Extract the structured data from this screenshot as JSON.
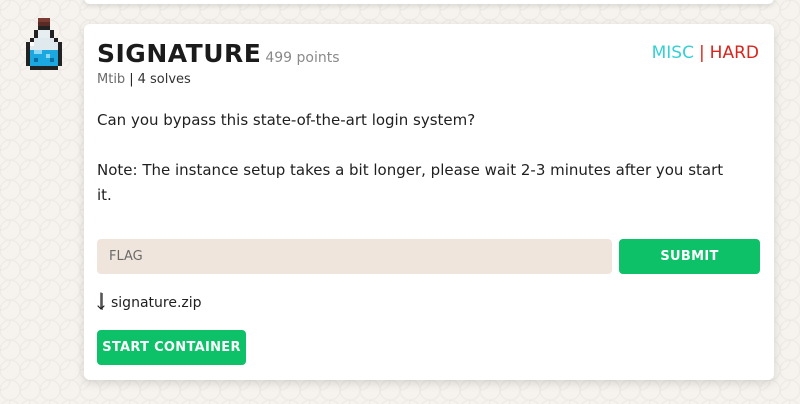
{
  "challenge": {
    "name": "SIGNATURE",
    "points": "499 points",
    "author": "Mtib",
    "separator": "|",
    "solves": "4 solves",
    "category": "MISC",
    "difficulty": "HARD",
    "description": [
      "Can you bypass this state-of-the-art login system?",
      "Note: The instance setup takes a bit longer, please wait 2-3 minutes after you start it."
    ]
  },
  "flag_form": {
    "placeholder": "FLAG",
    "value": "",
    "submit_label": "SUBMIT"
  },
  "attachment": {
    "filename": "signature.zip",
    "icon": "download-arrow-icon"
  },
  "container": {
    "start_label": "START CONTAINER"
  },
  "avatar": {
    "icon": "potion-bottle-icon"
  },
  "colors": {
    "category": "#35d0d6",
    "difficulty": "#d9241c",
    "button": "#0cc167",
    "input_bg": "#efe5dc"
  }
}
